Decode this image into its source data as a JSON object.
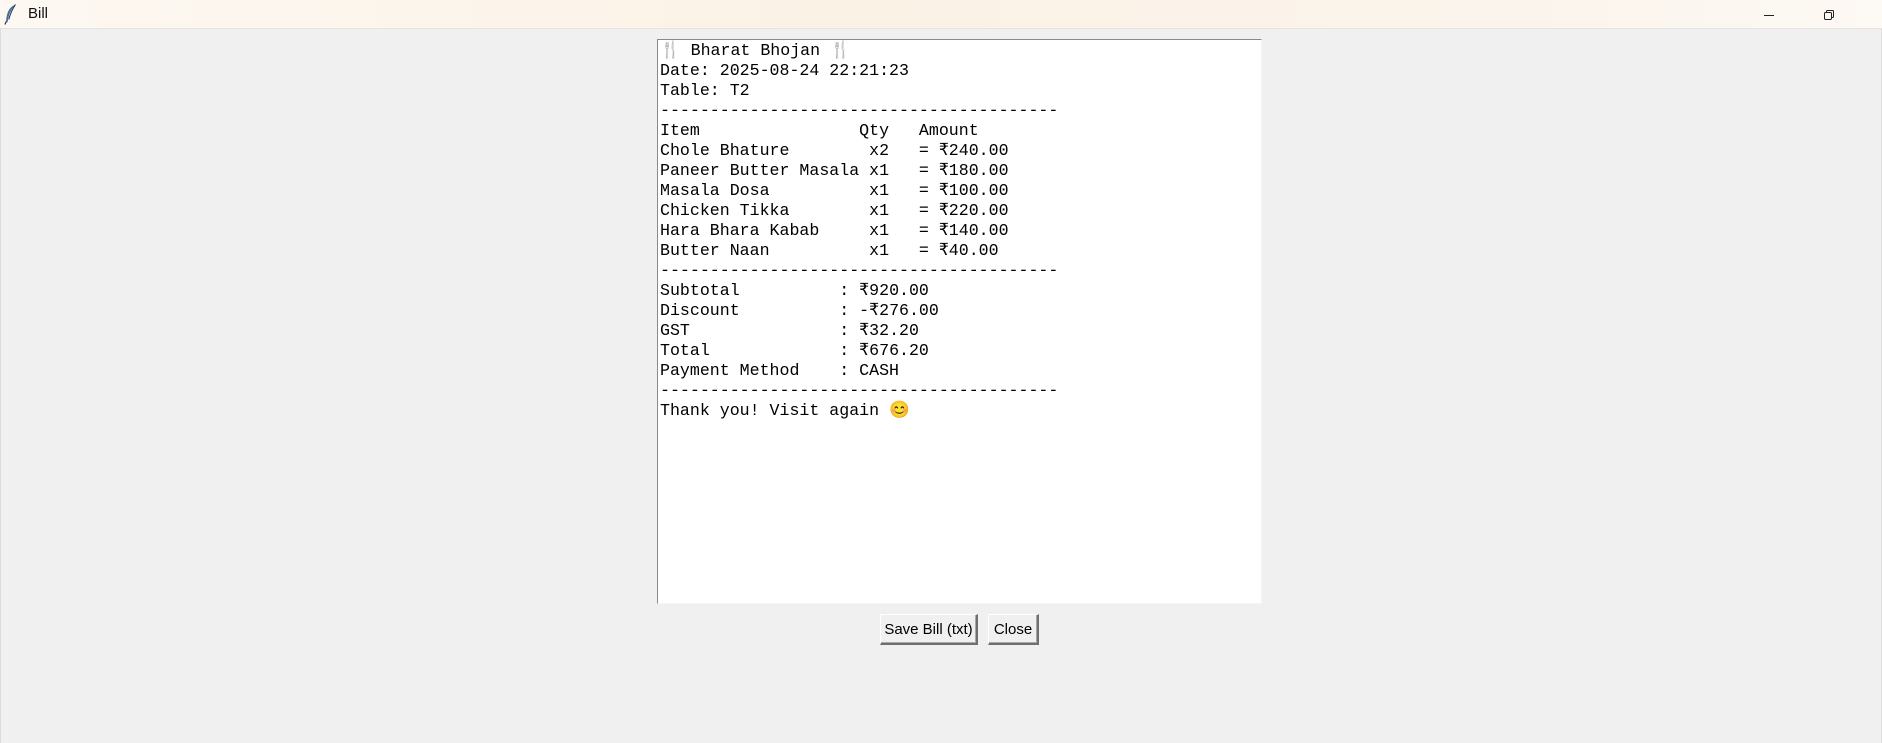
{
  "window": {
    "title": "Bill",
    "app_icon": "feather-icon",
    "controls": {
      "minimize": "minimize-icon",
      "restore": "restore-icon"
    }
  },
  "bill": {
    "lines": [
      {
        "name": "bill-header",
        "text": "🍴 Bharat Bhojan 🍴"
      },
      {
        "name": "bill-date",
        "text": "Date: 2025-08-24 22:21:23"
      },
      {
        "name": "bill-table",
        "text": "Table: T2"
      },
      {
        "name": "bill-separator",
        "text": "----------------------------------------"
      },
      {
        "name": "bill-columns-header",
        "text": "Item                Qty   Amount"
      },
      {
        "name": "bill-item",
        "text": "Chole Bhature        x2   = ₹240.00"
      },
      {
        "name": "bill-item",
        "text": "Paneer Butter Masala x1   = ₹180.00"
      },
      {
        "name": "bill-item",
        "text": "Masala Dosa          x1   = ₹100.00"
      },
      {
        "name": "bill-item",
        "text": "Chicken Tikka        x1   = ₹220.00"
      },
      {
        "name": "bill-item",
        "text": "Hara Bhara Kabab     x1   = ₹140.00"
      },
      {
        "name": "bill-item",
        "text": "Butter Naan          x1   = ₹40.00"
      },
      {
        "name": "bill-separator",
        "text": "----------------------------------------"
      },
      {
        "name": "bill-subtotal",
        "text": "Subtotal          : ₹920.00"
      },
      {
        "name": "bill-discount",
        "text": "Discount          : -₹276.00"
      },
      {
        "name": "bill-gst",
        "text": "GST               : ₹32.20"
      },
      {
        "name": "bill-total",
        "text": "Total             : ₹676.20"
      },
      {
        "name": "bill-payment-method",
        "text": "Payment Method    : CASH"
      },
      {
        "name": "bill-separator",
        "text": "----------------------------------------"
      },
      {
        "name": "bill-footer",
        "text": "Thank you! Visit again 😊"
      }
    ]
  },
  "buttons": {
    "save_label": "Save Bill (txt)",
    "close_label": "Close"
  }
}
